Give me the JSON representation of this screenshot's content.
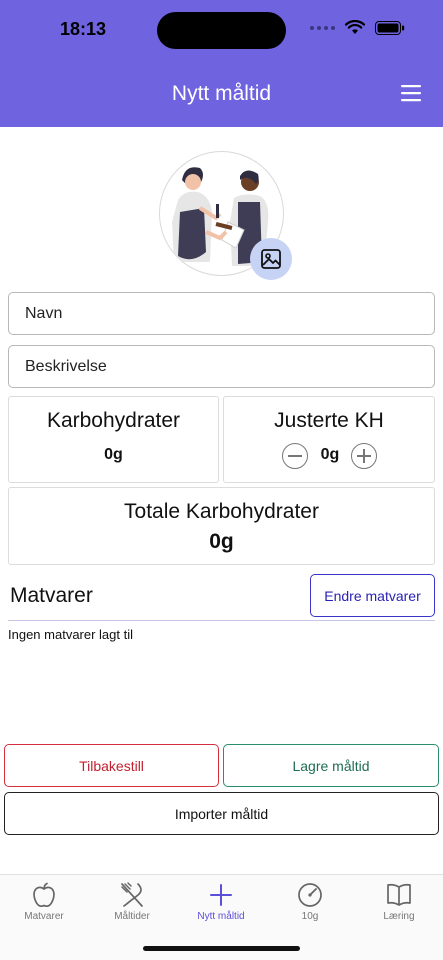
{
  "status_bar": {
    "time": "18:13"
  },
  "header": {
    "title": "Nytt måltid",
    "menu_icon": "hamburger-menu-icon"
  },
  "form": {
    "name_placeholder": "Navn",
    "description_placeholder": "Beskrivelse"
  },
  "carbs": {
    "title": "Karbohydrater",
    "value": "0g"
  },
  "adjusted": {
    "title": "Justerte KH",
    "value": "0g"
  },
  "total": {
    "title": "Totale Karbohydrater",
    "value": "0g"
  },
  "foods": {
    "heading": "Matvarer",
    "edit_label": "Endre matvarer",
    "empty_text": "Ingen matvarer lagt til"
  },
  "actions": {
    "reset_label": "Tilbakestill",
    "save_label": "Lagre måltid",
    "import_label": "Importer måltid"
  },
  "tabs": [
    {
      "label": "Matvarer",
      "icon": "apple-icon"
    },
    {
      "label": "Måltider",
      "icon": "utensils-icon"
    },
    {
      "label": "Nytt måltid",
      "icon": "plus-icon"
    },
    {
      "label": "10g",
      "icon": "gauge-icon"
    },
    {
      "label": "Læring",
      "icon": "book-icon"
    }
  ],
  "colors": {
    "header": "#6f63e0",
    "reset": "#d32f3f",
    "save": "#2a8e6b",
    "accent": "#5a4fd6"
  }
}
